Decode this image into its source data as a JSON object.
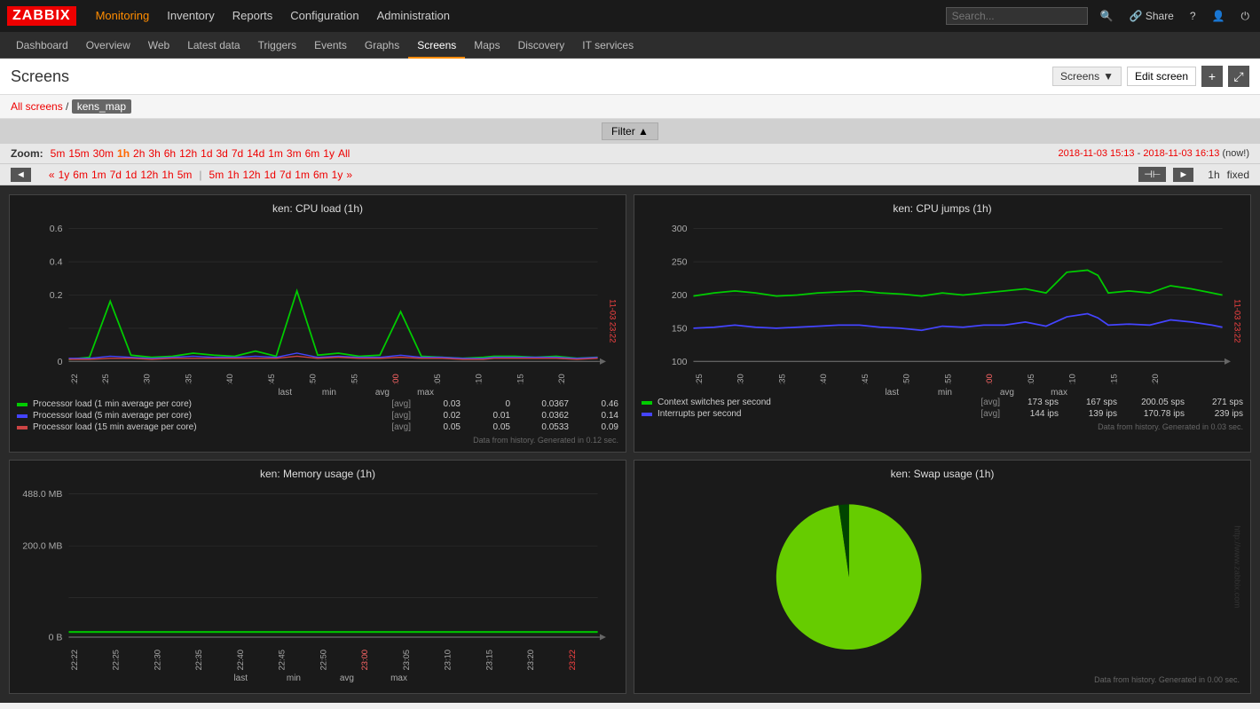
{
  "logo": "ZABBIX",
  "topNav": {
    "items": [
      {
        "label": "Monitoring",
        "active": true
      },
      {
        "label": "Inventory"
      },
      {
        "label": "Reports"
      },
      {
        "label": "Configuration"
      },
      {
        "label": "Administration"
      }
    ]
  },
  "secondNav": {
    "items": [
      {
        "label": "Dashboard"
      },
      {
        "label": "Overview"
      },
      {
        "label": "Web"
      },
      {
        "label": "Latest data"
      },
      {
        "label": "Triggers"
      },
      {
        "label": "Events"
      },
      {
        "label": "Graphs"
      },
      {
        "label": "Screens",
        "active": true
      },
      {
        "label": "Maps"
      },
      {
        "label": "Discovery"
      },
      {
        "label": "IT services"
      }
    ]
  },
  "pageTitle": "Screens",
  "header": {
    "dropdown": "Screens",
    "editBtn": "Edit screen",
    "plusBtn": "+",
    "expandBtn": "⤢"
  },
  "breadcrumb": {
    "allScreens": "All screens",
    "current": "kens_map"
  },
  "filter": {
    "label": "Filter ▲"
  },
  "zoom": {
    "label": "Zoom:",
    "items": [
      "5m",
      "15m",
      "30m",
      "1h",
      "2h",
      "3h",
      "6h",
      "12h",
      "1d",
      "3d",
      "7d",
      "14d",
      "1m",
      "3m",
      "6m",
      "1y",
      "All"
    ]
  },
  "timeRange": {
    "from": "2018-11-03 15:13",
    "to": "2018-11-03 16:13",
    "suffix": "(now!)"
  },
  "navBar": {
    "leftItems": [
      "«",
      "1y",
      "6m",
      "1m",
      "7d",
      "1d",
      "12h",
      "1h",
      "5m",
      "|",
      "5m",
      "1h",
      "12h",
      "1d",
      "7d",
      "1m",
      "6m",
      "1y",
      "»"
    ],
    "period": "1h",
    "fixed": "fixed"
  },
  "charts": [
    {
      "id": "cpu-load",
      "title": "ken: CPU load (1h)",
      "yMax": "0.6",
      "yMid": "0.4",
      "yLow": "0.2",
      "y0": "0",
      "legend": {
        "header": [
          "last",
          "min",
          "avg",
          "max"
        ],
        "rows": [
          {
            "color": "#00cc00",
            "label": "Processor load (1 min average per core)",
            "tag": "[avg]",
            "last": "0.03",
            "min": "0",
            "avg": "0.0367",
            "max": "0.46"
          },
          {
            "color": "#0000cc",
            "label": "Processor load (5 min average per core)",
            "tag": "[avg]",
            "last": "0.02",
            "min": "0.01",
            "avg": "0.0362",
            "max": "0.14"
          },
          {
            "color": "#cc0000",
            "label": "Processor load (15 min average per core)",
            "tag": "[avg]",
            "last": "0.05",
            "min": "0.05",
            "avg": "0.0533",
            "max": "0.09"
          }
        ]
      },
      "dataSource": "Data from history. Generated in 0.12 sec."
    },
    {
      "id": "cpu-jumps",
      "title": "ken: CPU jumps (1h)",
      "yMax": "300",
      "y250": "250",
      "y200": "200",
      "y150": "150",
      "y100": "100",
      "legend": {
        "header": [
          "last",
          "min",
          "avg",
          "max"
        ],
        "rows": [
          {
            "color": "#00cc00",
            "label": "Context switches per second",
            "tag": "[avg]",
            "last": "173 sps",
            "min": "167 sps",
            "avg": "200.05 sps",
            "max": "271 sps"
          },
          {
            "color": "#0000cc",
            "label": "Interrupts per second",
            "tag": "[avg]",
            "last": "144 ips",
            "min": "139 ips",
            "avg": "170.78 ips",
            "max": "239 ips"
          }
        ]
      },
      "dataSource": "Data from history. Generated in 0.03 sec."
    },
    {
      "id": "memory-usage",
      "title": "ken: Memory usage (1h)",
      "yMax": "488.0 MB",
      "yMid": "200.0 MB",
      "y0": "0 B",
      "legend": {
        "header": [
          "last",
          "min",
          "avg",
          "max"
        ],
        "rows": []
      },
      "dataSource": ""
    },
    {
      "id": "swap-usage",
      "title": "ken: Swap usage (1h)",
      "dataSource": "Data from history. Generated in 0.00 sec."
    }
  ],
  "timeLabels": [
    "22:22",
    "22:25",
    "22:30",
    "22:35",
    "22:40",
    "22:45",
    "22:50",
    "22:55",
    "23:00",
    "23:05",
    "23:10",
    "23:15",
    "23:20"
  ]
}
